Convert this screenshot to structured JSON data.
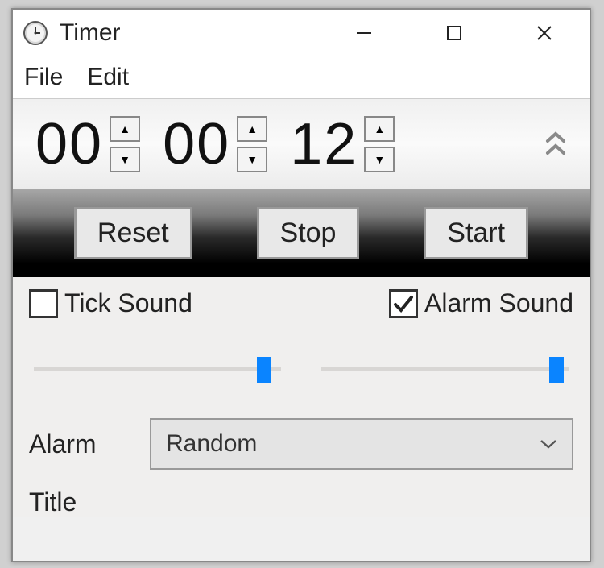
{
  "titlebar": {
    "title": "Timer"
  },
  "menubar": {
    "file": "File",
    "edit": "Edit"
  },
  "timer": {
    "hours": "00",
    "minutes": "00",
    "seconds": "12"
  },
  "buttons": {
    "reset": "Reset",
    "stop": "Stop",
    "start": "Start"
  },
  "options": {
    "tick_label": "Tick Sound",
    "tick_checked": false,
    "alarm_label": "Alarm Sound",
    "alarm_checked": true,
    "tick_volume_percent": 93,
    "alarm_volume_percent": 95
  },
  "alarm": {
    "label": "Alarm",
    "selected": "Random"
  },
  "title_field": {
    "label": "Title"
  }
}
